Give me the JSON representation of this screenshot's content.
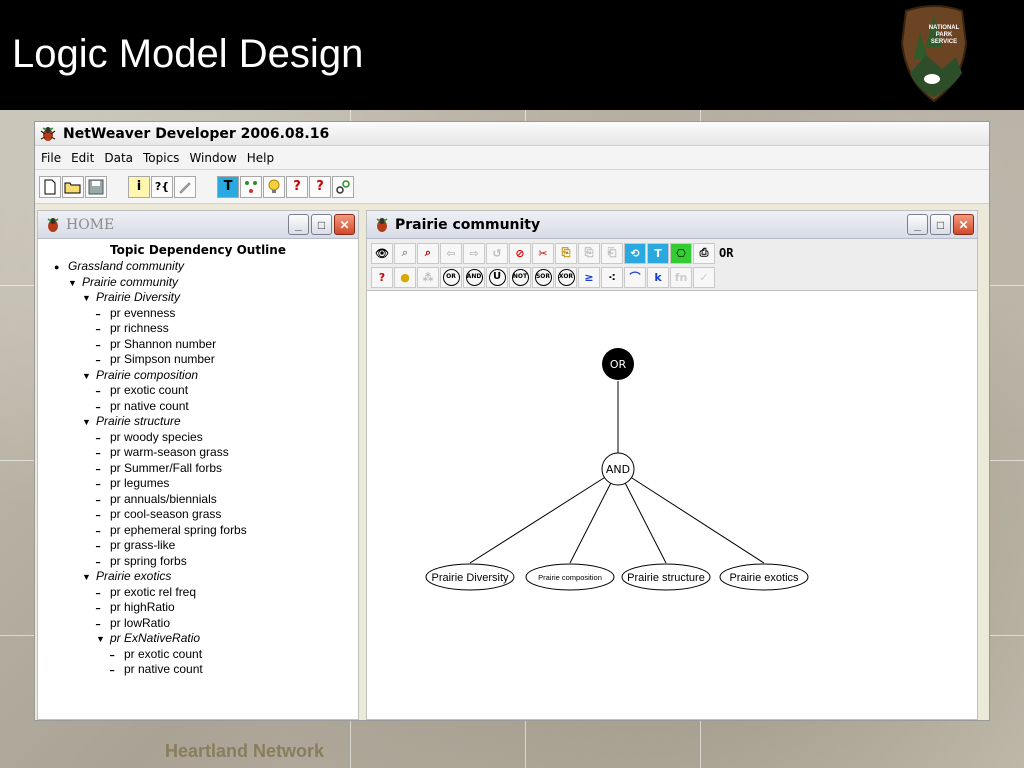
{
  "slide": {
    "title": "Logic Model Design",
    "logo_text": [
      "NATIONAL",
      "PARK",
      "SERVICE"
    ],
    "footer": "Heartland Network"
  },
  "app": {
    "title": "NetWeaver Developer 2006.08.16",
    "menu": [
      "File",
      "Edit",
      "Data",
      "Topics",
      "Window",
      "Help"
    ],
    "toolbar": [
      "new-file",
      "open-folder",
      "save",
      "info",
      "topic-info",
      "pencil",
      "topic",
      "node-tree",
      "bulb",
      "question-arrow",
      "help",
      "link-help"
    ],
    "toolbar_glyphs": {
      "info": "i",
      "topic": "T",
      "help": "?",
      "q_arrow": "?"
    }
  },
  "home": {
    "title": "HOME",
    "outline_title": "Topic Dependency Outline",
    "items": [
      {
        "text": "Grassland community",
        "level": 0,
        "marker": "dot",
        "italic": true
      },
      {
        "text": "Prairie community",
        "level": 1,
        "marker": "tri",
        "italic": true
      },
      {
        "text": "Prairie Diversity",
        "level": 2,
        "marker": "tri",
        "italic": true
      },
      {
        "text": "pr evenness",
        "level": 3,
        "marker": "dash",
        "italic": false
      },
      {
        "text": "pr richness",
        "level": 3,
        "marker": "dash",
        "italic": false
      },
      {
        "text": "pr Shannon number",
        "level": 3,
        "marker": "dash",
        "italic": false
      },
      {
        "text": "pr Simpson number",
        "level": 3,
        "marker": "dash",
        "italic": false
      },
      {
        "text": "Prairie composition",
        "level": 2,
        "marker": "tri",
        "italic": true
      },
      {
        "text": "pr exotic count",
        "level": 3,
        "marker": "dash",
        "italic": false
      },
      {
        "text": "pr native count",
        "level": 3,
        "marker": "dash",
        "italic": false
      },
      {
        "text": "Prairie structure",
        "level": 2,
        "marker": "tri",
        "italic": true
      },
      {
        "text": "pr woody species",
        "level": 3,
        "marker": "dash",
        "italic": false
      },
      {
        "text": "pr warm-season grass",
        "level": 3,
        "marker": "dash",
        "italic": false
      },
      {
        "text": "pr Summer/Fall forbs",
        "level": 3,
        "marker": "dash",
        "italic": false
      },
      {
        "text": "pr legumes",
        "level": 3,
        "marker": "dash",
        "italic": false
      },
      {
        "text": "pr annuals/biennials",
        "level": 3,
        "marker": "dash",
        "italic": false
      },
      {
        "text": "pr cool-season grass",
        "level": 3,
        "marker": "dash",
        "italic": false
      },
      {
        "text": "pr ephemeral spring forbs",
        "level": 3,
        "marker": "dash",
        "italic": false
      },
      {
        "text": "pr grass-like",
        "level": 3,
        "marker": "dash",
        "italic": false
      },
      {
        "text": "pr spring forbs",
        "level": 3,
        "marker": "dash",
        "italic": false
      },
      {
        "text": "Prairie exotics",
        "level": 2,
        "marker": "tri",
        "italic": true
      },
      {
        "text": "pr exotic rel freq",
        "level": 3,
        "marker": "dash",
        "italic": false
      },
      {
        "text": "pr highRatio",
        "level": 3,
        "marker": "dash",
        "italic": false
      },
      {
        "text": "pr lowRatio",
        "level": 3,
        "marker": "dash",
        "italic": false
      },
      {
        "text": "pr ExNativeRatio",
        "level": 3,
        "marker": "tri",
        "italic": true
      },
      {
        "text": "pr exotic count",
        "level": 4,
        "marker": "dash",
        "italic": false
      },
      {
        "text": "pr native count",
        "level": 4,
        "marker": "dash",
        "italic": false
      }
    ]
  },
  "prairie": {
    "title": "Prairie community",
    "selected_operator": "OR",
    "operators": [
      "OR",
      "AND",
      "U",
      "NOT",
      "SOR",
      "XOR"
    ],
    "graph": {
      "root": "OR",
      "middle": "AND",
      "leaves": [
        "Prairie Diversity",
        "Prairie composition",
        "Prairie structure",
        "Prairie exotics"
      ]
    }
  },
  "colors": {
    "header_bg": "#000000",
    "footer_text": "#8a7d5c",
    "close_button": "#d24a2b"
  }
}
